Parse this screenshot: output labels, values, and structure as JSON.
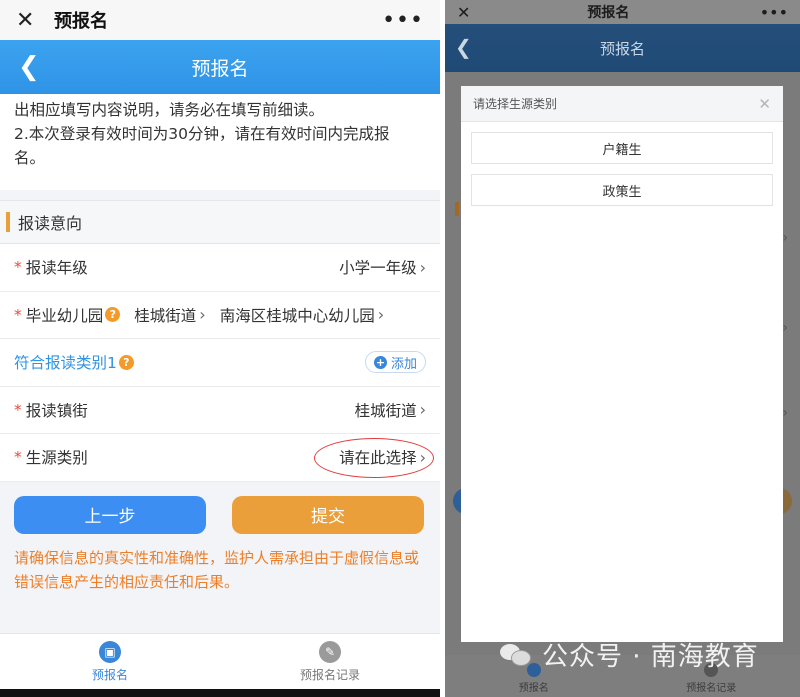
{
  "left": {
    "wx_bar": {
      "title": "预报名"
    },
    "app_header": {
      "title": "预报名"
    },
    "notice": {
      "line1": "出相应填写内容说明，请务必在填写前细读。",
      "line2": "2.本次登录有效时间为30分钟，请在有效时间内完成报名。"
    },
    "section_title": "报读意向",
    "form": {
      "grade": {
        "required": "*",
        "label": "报读年级",
        "value": "小学一年级"
      },
      "kindergarten": {
        "required": "*",
        "label": "毕业幼儿园",
        "street": "桂城街道",
        "school": "南海区桂城中心幼儿园"
      },
      "category": {
        "label": "符合报读类别1",
        "add_label": "添加"
      },
      "town": {
        "required": "*",
        "label": "报读镇街",
        "value": "桂城街道"
      },
      "source": {
        "required": "*",
        "label": "生源类别",
        "value": "请在此选择"
      }
    },
    "buttons": {
      "prev": "上一步",
      "submit": "提交"
    },
    "warning": "请确保信息的真实性和准确性，监护人需承担由于虚假信息或错误信息产生的相应责任和后果。",
    "tabs": [
      {
        "label": "预报名",
        "active": true
      },
      {
        "label": "预报名记录",
        "active": false
      }
    ],
    "colors": {
      "primary": "#2f93e6",
      "accent": "#ea9f3b",
      "required": "#e94b3c",
      "warning": "#ee7f2a"
    }
  },
  "right": {
    "wx_bar": {
      "title": "预报名"
    },
    "app_header": {
      "title": "预报名"
    },
    "modal": {
      "title": "请选择生源类别",
      "options": [
        "户籍生",
        "政策生"
      ]
    },
    "tabs": [
      {
        "label": "预报名"
      },
      {
        "label": "预报名记录"
      }
    ]
  },
  "watermark": {
    "text": "公众号 · 南海教育"
  }
}
